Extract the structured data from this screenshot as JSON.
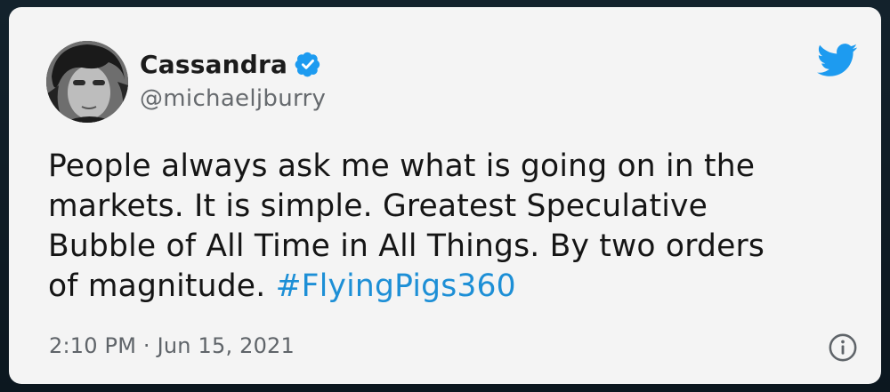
{
  "tweet": {
    "display_name": "Cassandra",
    "handle": "@michaeljburry",
    "text_lines": [
      "People always ask me what is going on in the",
      "markets. It is simple. Greatest Speculative",
      "Bubble of All Time in All Things. By two orders",
      "of magnitude."
    ],
    "hashtag": "#FlyingPigs360",
    "timestamp": "2:10 PM · Jun 15, 2021"
  },
  "icons": {
    "verified": "verified-badge-icon",
    "brand": "twitter-bird-icon",
    "info": "info-icon",
    "avatar": "profile-avatar"
  },
  "colors": {
    "verified_blue": "#1d9bf0",
    "hashtag_blue": "#1d8fd6",
    "twitter_blue": "#1d9bf0",
    "card_background": "#f4f4f4"
  }
}
